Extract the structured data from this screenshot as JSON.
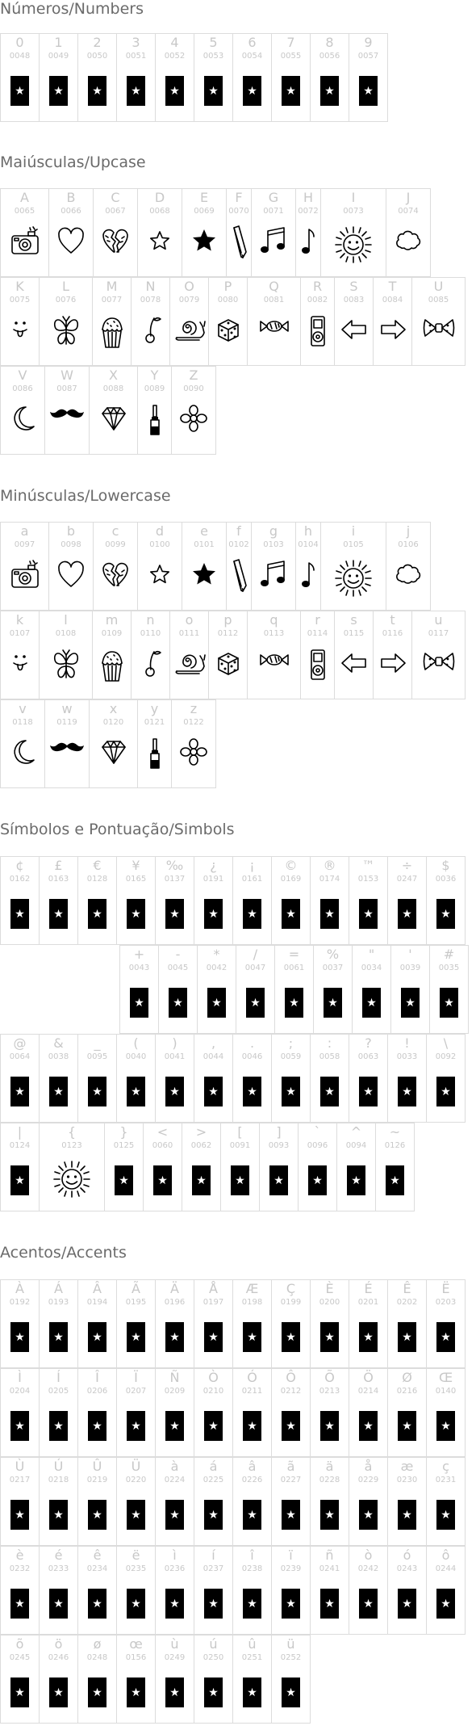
{
  "sections": [
    {
      "title": "Números/Numbers",
      "rows": [
        [
          [
            "0",
            "0048",
            "star"
          ],
          [
            "1",
            "0049",
            "star"
          ],
          [
            "2",
            "0050",
            "star"
          ],
          [
            "3",
            "0051",
            "star"
          ],
          [
            "4",
            "0052",
            "star"
          ],
          [
            "5",
            "0053",
            "star"
          ],
          [
            "6",
            "0054",
            "star"
          ],
          [
            "7",
            "0055",
            "star"
          ],
          [
            "8",
            "0056",
            "star"
          ],
          [
            "9",
            "0057",
            "star"
          ]
        ]
      ]
    },
    {
      "title": "Maiúsculas/Upcase",
      "rows": [
        [
          [
            "A",
            "0065",
            "camera"
          ],
          [
            "B",
            "0066",
            "heart"
          ],
          [
            "C",
            "0067",
            "broken-heart"
          ],
          [
            "D",
            "0068",
            "star-outline"
          ],
          [
            "E",
            "0069",
            "star-filled"
          ],
          [
            "F",
            "0070",
            "pencil"
          ],
          [
            "G",
            "0071",
            "double-note"
          ],
          [
            "H",
            "0072",
            "single-note"
          ],
          [
            "I",
            "0073",
            "sun"
          ],
          [
            "J",
            "0074",
            "cloud"
          ]
        ],
        [
          [
            "K",
            "0075",
            "tongue-face"
          ],
          [
            "L",
            "0076",
            "butterfly"
          ],
          [
            "M",
            "0077",
            "cupcake"
          ],
          [
            "N",
            "0078",
            "cherry"
          ],
          [
            "O",
            "0079",
            "snail"
          ],
          [
            "P",
            "0080",
            "dice"
          ],
          [
            "Q",
            "0081",
            "candy"
          ],
          [
            "R",
            "0082",
            "music-player"
          ],
          [
            "S",
            "0083",
            "arrow-left"
          ],
          [
            "T",
            "0084",
            "arrow-right"
          ],
          [
            "U",
            "0085",
            "bow-tie"
          ]
        ],
        [
          [
            "V",
            "0086",
            "moon"
          ],
          [
            "W",
            "0087",
            "mustache"
          ],
          [
            "X",
            "0088",
            "diamond"
          ],
          [
            "Y",
            "0089",
            "nail-polish"
          ],
          [
            "Z",
            "0090",
            "flower"
          ]
        ]
      ]
    },
    {
      "title": "Minúsculas/Lowercase",
      "rows": [
        [
          [
            "a",
            "0097",
            "camera"
          ],
          [
            "b",
            "0098",
            "heart"
          ],
          [
            "c",
            "0099",
            "broken-heart"
          ],
          [
            "d",
            "0100",
            "star-outline"
          ],
          [
            "e",
            "0101",
            "star-filled"
          ],
          [
            "f",
            "0102",
            "pencil"
          ],
          [
            "g",
            "0103",
            "double-note"
          ],
          [
            "h",
            "0104",
            "single-note"
          ],
          [
            "i",
            "0105",
            "sun"
          ],
          [
            "j",
            "0106",
            "cloud"
          ]
        ],
        [
          [
            "k",
            "0107",
            "tongue-face"
          ],
          [
            "l",
            "0108",
            "butterfly"
          ],
          [
            "m",
            "0109",
            "cupcake"
          ],
          [
            "n",
            "0110",
            "cherry"
          ],
          [
            "o",
            "0111",
            "snail"
          ],
          [
            "p",
            "0112",
            "dice"
          ],
          [
            "q",
            "0113",
            "candy"
          ],
          [
            "r",
            "0114",
            "music-player"
          ],
          [
            "s",
            "0115",
            "arrow-left"
          ],
          [
            "t",
            "0116",
            "arrow-right"
          ],
          [
            "u",
            "0117",
            "bow-tie"
          ]
        ],
        [
          [
            "v",
            "0118",
            "moon"
          ],
          [
            "w",
            "0119",
            "mustache"
          ],
          [
            "x",
            "0120",
            "diamond"
          ],
          [
            "y",
            "0121",
            "nail-polish"
          ],
          [
            "z",
            "0122",
            "flower"
          ]
        ]
      ]
    },
    {
      "title": "Símbolos e Pontuação/Simbols",
      "rows": [
        [
          [
            "¢",
            "0162",
            "star"
          ],
          [
            "£",
            "0163",
            "star"
          ],
          [
            "€",
            "0128",
            "star"
          ],
          [
            "¥",
            "0165",
            "star"
          ],
          [
            "‰",
            "0137",
            "star"
          ],
          [
            "¿",
            "0191",
            "star"
          ],
          [
            "¡",
            "0161",
            "star"
          ],
          [
            "©",
            "0169",
            "star"
          ],
          [
            "®",
            "0174",
            "star"
          ],
          [
            "™",
            "0153",
            "star"
          ],
          [
            "÷",
            "0247",
            "star"
          ],
          [
            "$",
            "0036",
            "star"
          ]
        ],
        [
          [
            "+",
            "0043",
            "star"
          ],
          [
            "-",
            "0045",
            "star"
          ],
          [
            "*",
            "0042",
            "star"
          ],
          [
            "/",
            "0047",
            "star"
          ],
          [
            "=",
            "0061",
            "star"
          ],
          [
            "%",
            "0037",
            "star"
          ],
          [
            "\"",
            "0034",
            "star"
          ],
          [
            "'",
            "0039",
            "star"
          ],
          [
            "#",
            "0035",
            "star"
          ]
        ],
        [
          [
            "@",
            "0064",
            "star"
          ],
          [
            "&",
            "0038",
            "star"
          ],
          [
            "_",
            "0095",
            "star"
          ],
          [
            "(",
            "0040",
            "star"
          ],
          [
            ")",
            "0041",
            "star"
          ],
          [
            ",",
            "0044",
            "star"
          ],
          [
            ".",
            "0046",
            "star"
          ],
          [
            ";",
            "0059",
            "star"
          ],
          [
            ":",
            "0058",
            "star"
          ],
          [
            "?",
            "0063",
            "star"
          ],
          [
            "!",
            "0033",
            "star"
          ],
          [
            "\\",
            "0092",
            "star"
          ]
        ],
        [
          [
            "|",
            "0124",
            "star"
          ],
          [
            "{",
            "0123",
            "sun"
          ],
          [
            "}",
            "0125",
            "star"
          ],
          [
            "<",
            "0060",
            "star"
          ],
          [
            ">",
            "0062",
            "star"
          ],
          [
            "[",
            "0091",
            "star"
          ],
          [
            "]",
            "0093",
            "star"
          ],
          [
            "`",
            "0096",
            "star"
          ],
          [
            "^",
            "0094",
            "star"
          ],
          [
            "~",
            "0126",
            "star"
          ]
        ]
      ]
    },
    {
      "title": "Acentos/Accents",
      "rows": [
        [
          [
            "À",
            "0192",
            "star"
          ],
          [
            "Á",
            "0193",
            "star"
          ],
          [
            "Â",
            "0194",
            "star"
          ],
          [
            "Ã",
            "0195",
            "star"
          ],
          [
            "Ä",
            "0196",
            "star"
          ],
          [
            "Å",
            "0197",
            "star"
          ],
          [
            "Æ",
            "0198",
            "star"
          ],
          [
            "Ç",
            "0199",
            "star"
          ],
          [
            "È",
            "0200",
            "star"
          ],
          [
            "É",
            "0201",
            "star"
          ],
          [
            "Ê",
            "0202",
            "star"
          ],
          [
            "Ë",
            "0203",
            "star"
          ]
        ],
        [
          [
            "Ì",
            "0204",
            "star"
          ],
          [
            "Í",
            "0205",
            "star"
          ],
          [
            "Î",
            "0206",
            "star"
          ],
          [
            "Ï",
            "0207",
            "star"
          ],
          [
            "Ñ",
            "0209",
            "star"
          ],
          [
            "Ò",
            "0210",
            "star"
          ],
          [
            "Ó",
            "0211",
            "star"
          ],
          [
            "Ô",
            "0212",
            "star"
          ],
          [
            "Õ",
            "0213",
            "star"
          ],
          [
            "Ö",
            "0214",
            "star"
          ],
          [
            "Ø",
            "0216",
            "star"
          ],
          [
            "Œ",
            "0140",
            "star"
          ]
        ],
        [
          [
            "Ù",
            "0217",
            "star"
          ],
          [
            "Ú",
            "0218",
            "star"
          ],
          [
            "Û",
            "0219",
            "star"
          ],
          [
            "Ü",
            "0220",
            "star"
          ],
          [
            "à",
            "0224",
            "star"
          ],
          [
            "á",
            "0225",
            "star"
          ],
          [
            "â",
            "0226",
            "star"
          ],
          [
            "ã",
            "0227",
            "star"
          ],
          [
            "ä",
            "0228",
            "star"
          ],
          [
            "å",
            "0229",
            "star"
          ],
          [
            "æ",
            "0230",
            "star"
          ],
          [
            "ç",
            "0231",
            "star"
          ]
        ],
        [
          [
            "è",
            "0232",
            "star"
          ],
          [
            "é",
            "0233",
            "star"
          ],
          [
            "ê",
            "0234",
            "star"
          ],
          [
            "ë",
            "0235",
            "star"
          ],
          [
            "ì",
            "0236",
            "star"
          ],
          [
            "í",
            "0237",
            "star"
          ],
          [
            "î",
            "0238",
            "star"
          ],
          [
            "ï",
            "0239",
            "star"
          ],
          [
            "ñ",
            "0241",
            "star"
          ],
          [
            "ò",
            "0242",
            "star"
          ],
          [
            "ó",
            "0243",
            "star"
          ],
          [
            "ô",
            "0244",
            "star"
          ]
        ],
        [
          [
            "õ",
            "0245",
            "star"
          ],
          [
            "ö",
            "0246",
            "star"
          ],
          [
            "ø",
            "0248",
            "star"
          ],
          [
            "œ",
            "0156",
            "star"
          ],
          [
            "ù",
            "0249",
            "star"
          ],
          [
            "ú",
            "0250",
            "star"
          ],
          [
            "û",
            "0251",
            "star"
          ],
          [
            "ü",
            "0252",
            "star"
          ]
        ]
      ]
    }
  ]
}
